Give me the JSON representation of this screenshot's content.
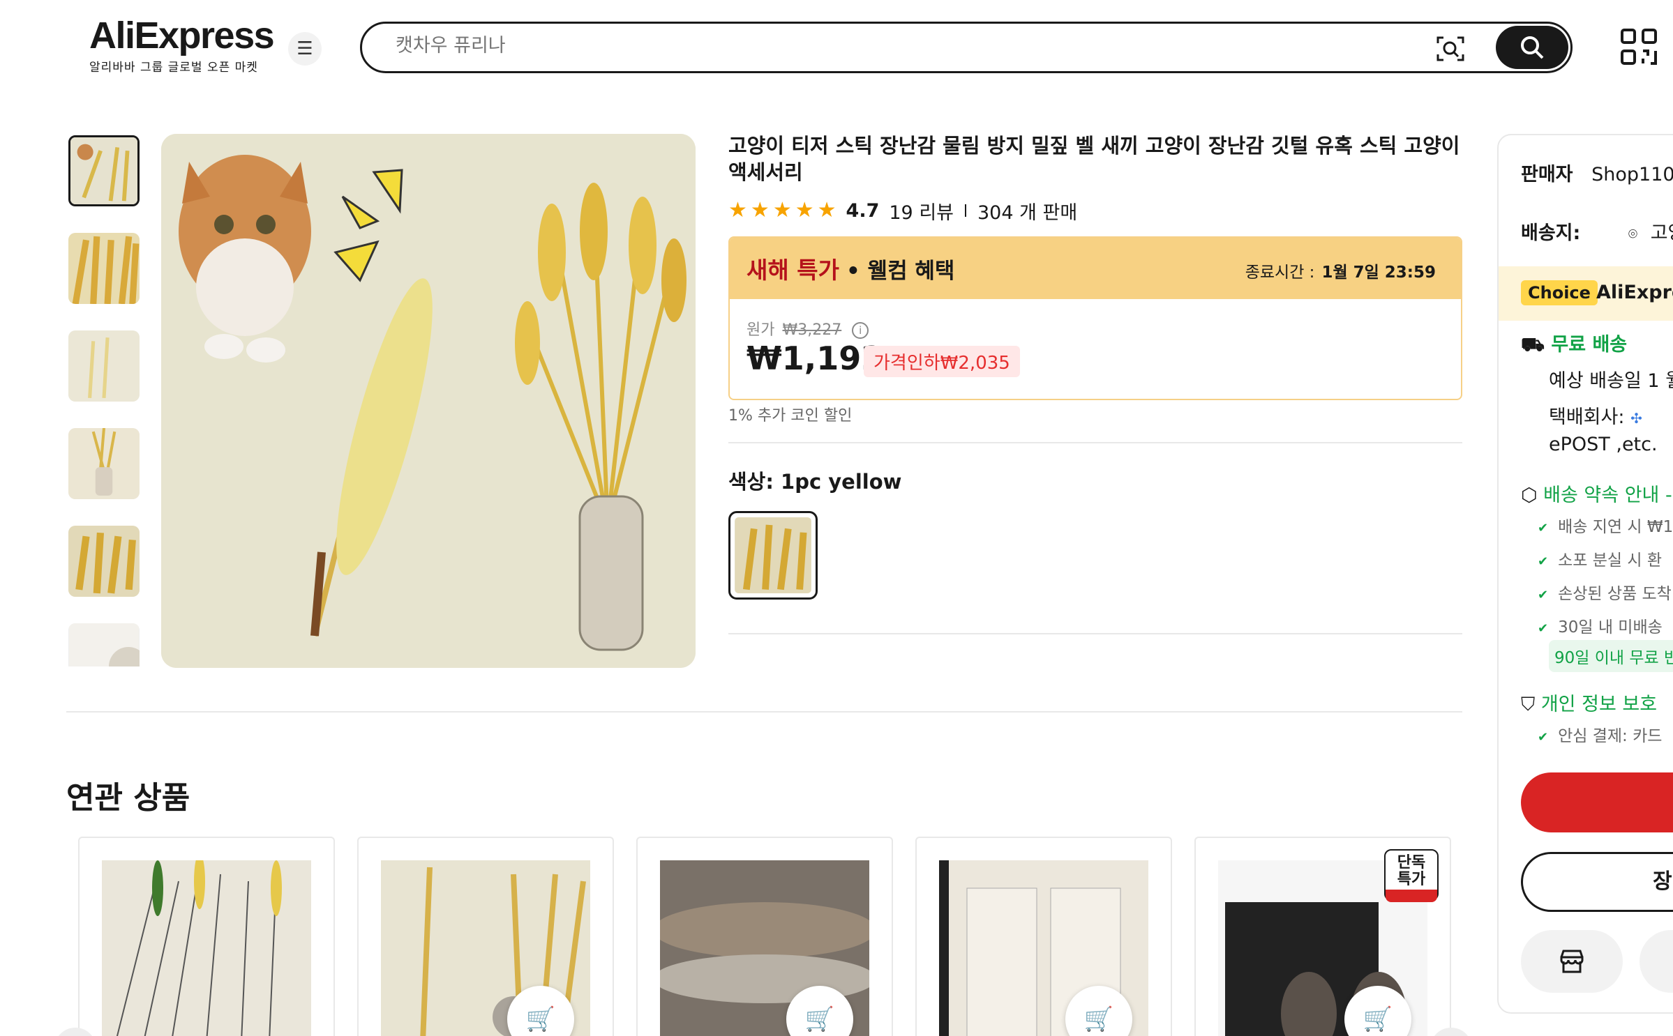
{
  "header": {
    "logo": "AliExpress",
    "logo_sub": "알리바바 그룹 글로벌 오픈 마켓",
    "search_placeholder": "캣차우 퓨리나"
  },
  "product": {
    "title": "고양이 티저 스틱 장난감 물림 방지 밀짚 벨 새끼 고양이 장난감 깃털 유혹 스틱 고양이 액세서리",
    "rating": "4.7",
    "reviews": "19 리뷰",
    "sold": "304 개 판매",
    "deal": {
      "title": "새해 특가",
      "welcome": "• 웰컴 혜택",
      "end_label": "종료시간 :",
      "end_time": "1월 7일 23:59",
      "original_label": "원가",
      "original_price": "₩3,227",
      "price": "₩1,192",
      "discount": "가격인하₩2,035"
    },
    "coin_note": "1% 추가 코인 할인",
    "color_label": "색상: 1pc yellow"
  },
  "side": {
    "seller_label": "판매자",
    "seller_name": "Shop1102",
    "ship_label": "배송지:",
    "ship_value": "고양",
    "choice_badge": "Choice",
    "choice_text": "AliExpre",
    "free_ship": "무료 배송",
    "est_delivery": "예상 배송일 1 월",
    "courier": "택배회사:",
    "courier_tail": "ePOST ,etc.",
    "promise": "배송 약속 안내 -",
    "promise_items": [
      "배송 지연 시 ₩1",
      "소포 분실 시 환",
      "손상된 상품 도착",
      "30일 내 미배송"
    ],
    "return_pill": "90일 이내 무료 반",
    "privacy": "개인 정보 보호",
    "privacy_item": "안심 결제: 카드",
    "cart_btn": "장"
  },
  "related": {
    "title": "연관 상품",
    "badge": "단독\n특가"
  },
  "colors": {
    "accent_red": "#d92424",
    "deal_bg": "#f7d183",
    "green": "#11a246"
  }
}
